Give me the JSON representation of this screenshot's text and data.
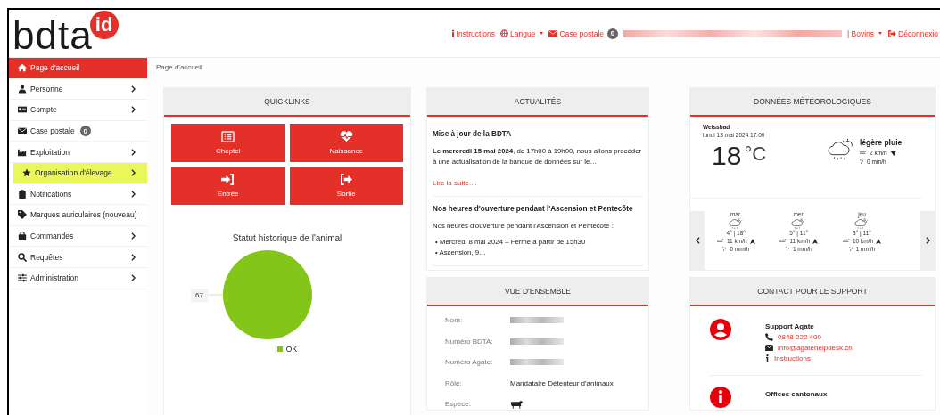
{
  "logo": {
    "text": "bdta",
    "badge": "id"
  },
  "top_nav": [
    {
      "kind": "info",
      "label": "Instructions",
      "caret": false
    },
    {
      "kind": "globe",
      "label": "Langue",
      "caret": true
    },
    {
      "kind": "mail",
      "label": "Case postale",
      "caret": false,
      "badge": "0"
    },
    {
      "kind": "redacted"
    },
    {
      "kind": "plain",
      "label": "| Bovins",
      "caret": true
    },
    {
      "kind": "logout",
      "label": "Déconnexio",
      "caret": false
    }
  ],
  "sidebar": {
    "items": [
      {
        "label": "Page d'accueil",
        "selected": true,
        "highlighted": false,
        "submenu": false
      },
      {
        "label": "Personne",
        "selected": false,
        "highlighted": false,
        "submenu": true
      },
      {
        "label": "Compte",
        "selected": false,
        "highlighted": false,
        "submenu": true
      },
      {
        "label": "Case postale",
        "selected": false,
        "highlighted": false,
        "submenu": false,
        "badge": "0"
      },
      {
        "label": "Exploitation",
        "selected": false,
        "highlighted": false,
        "submenu": true
      },
      {
        "label": "Organisation d'élevage",
        "selected": false,
        "highlighted": true,
        "submenu": true
      },
      {
        "label": "Notifications",
        "selected": false,
        "highlighted": false,
        "submenu": true
      },
      {
        "label": "Marques auriculaires (nouveau)",
        "selected": false,
        "highlighted": false,
        "submenu": false
      },
      {
        "label": "Commandes",
        "selected": false,
        "highlighted": false,
        "submenu": true
      },
      {
        "label": "Requêtes",
        "selected": false,
        "highlighted": false,
        "submenu": true
      },
      {
        "label": "Administration",
        "selected": false,
        "highlighted": false,
        "submenu": true
      }
    ]
  },
  "breadcrumb": "Page d'accueil",
  "quicklinks": {
    "title": "QUICKLINKS",
    "buttons": [
      "Cheptel",
      "Naissance",
      "Entrée",
      "Sortie"
    ],
    "chart_data": {
      "type": "pie",
      "title": "Statut historique de l'animal",
      "series": [
        {
          "name": "OK",
          "color": "#84c51a",
          "values": [
            67
          ]
        }
      ],
      "data_labels": true
    }
  },
  "news": {
    "title": "ACTUALITÉS",
    "items": [
      {
        "heading": "Mise à jour de la BDTA",
        "text": "**Le mercredi 15 mai 2024**, de 17h00 à 19h00, nous allons procéder à une actualisation de la banque de données sur le…",
        "link": "Lire la suite...."
      },
      {
        "heading": "Nos heures d'ouverture pendant l'Ascension et Pentecôte",
        "text": "Nos heures d'ouverture pendant l'Ascension et Pentecôte :",
        "bullets": [
          {
            "marker": "•",
            "text": "Mercredi 8 mai 2024 – Fermé à partir de 15h30"
          },
          {
            "marker": "•",
            "text": "Ascension, 9…"
          }
        ]
      }
    ]
  },
  "weather": {
    "title": "DONNÉES MÉTÉOROLOGIQUES",
    "place": "Weissbad",
    "datetime": "lundi 13 mai 2024 17:00",
    "temperature": "18",
    "unit": "°C",
    "condition": "légère pluie",
    "wind": "2 km/h",
    "rain": "0 mm/h",
    "forecast": [
      {
        "day": "mar.",
        "temps": "4° | 18°",
        "wind": "11 km/h",
        "rain": "0 mm/h"
      },
      {
        "day": "mer.",
        "temps": "5° | 11°",
        "wind": "11 km/h",
        "rain": "1 mm/h"
      },
      {
        "day": "jeu",
        "temps": "3° | 11°",
        "wind": "10 km/h",
        "rain": "1 mm/h"
      }
    ]
  },
  "overview": {
    "title": "VUE D'ENSEMBLE",
    "rows": [
      {
        "label": "Nom:",
        "kind": "redacted"
      },
      {
        "label": "Numéro BDTA:",
        "kind": "redacted"
      },
      {
        "label": "Numéro Agate:",
        "kind": "redacted"
      },
      {
        "label": "Rôle:",
        "kind": "text",
        "value": "Mandataire Détenteur d'animaux"
      },
      {
        "label": "Espèce:",
        "kind": "cow"
      }
    ]
  },
  "support": {
    "title": "CONTACT POUR LE SUPPORT",
    "contacts": [
      {
        "kind": "person",
        "name": "Support Agate",
        "lines": [
          {
            "kind": "phone",
            "text": "0848 222 400"
          },
          {
            "kind": "mail",
            "text": "info@agatehelpdesk.ch"
          },
          {
            "kind": "info",
            "text": "Instructions"
          }
        ]
      },
      {
        "kind": "info",
        "name": "Offices cantonaux"
      }
    ]
  }
}
